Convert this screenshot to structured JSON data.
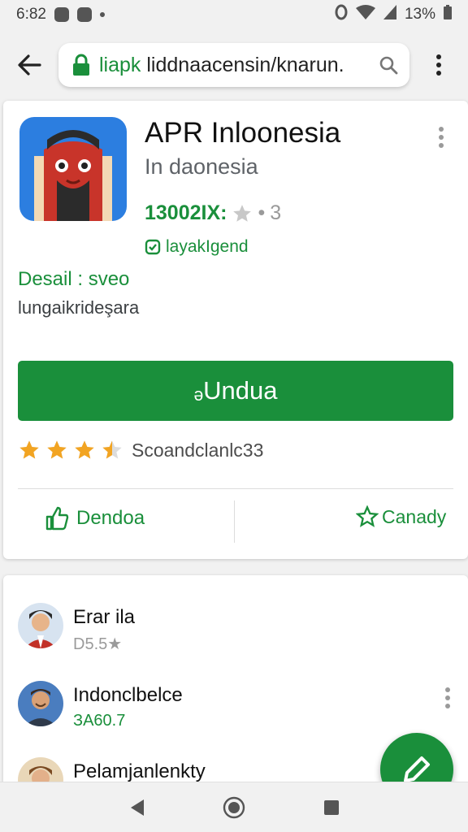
{
  "status_bar": {
    "time": "6:82",
    "battery": "13%"
  },
  "browser": {
    "url_green": "liapk",
    "url_dark": " liddnaacensin/knarun.",
    "icons": [
      "back-arrow-icon",
      "lock-icon",
      "search-icon",
      "more-vert-icon"
    ]
  },
  "app": {
    "name": "APR Inloonesia",
    "developer": "In daonesia",
    "downloads": "13002IX:",
    "stat_tail": "3",
    "badge": "layakIgend",
    "desc_line1": "Desail : sveo",
    "desc_line2": "lungaikrideşara",
    "install_label": "ₔUndua",
    "rating_text": "Scoandclanlc33",
    "rating_value": 3.5,
    "action_left": "Dendoa",
    "action_right": "Canady"
  },
  "reviews": [
    {
      "name": "Erar ila",
      "meta": "D5.5"
    },
    {
      "name": "Indonclbelce",
      "meta": "ЗА60.7"
    },
    {
      "name": "Pelamjanlenkty",
      "meta": ""
    }
  ],
  "colors": {
    "accent": "#1a8f3b",
    "star": "#f2a422",
    "app_icon_bg": "#2c7ee0"
  }
}
